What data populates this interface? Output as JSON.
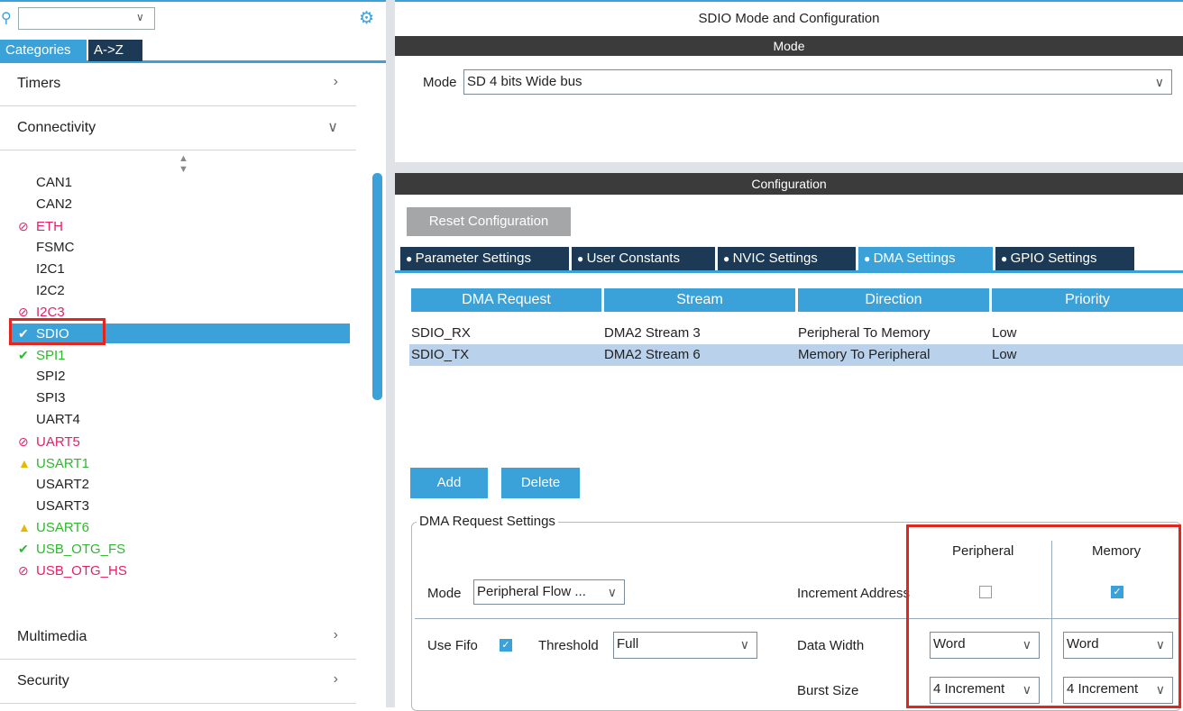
{
  "left": {
    "search": {
      "value": ""
    },
    "tabs": [
      "Categories",
      "A->Z"
    ],
    "categories": [
      {
        "label": "Timers",
        "arrow": ">"
      },
      {
        "label": "Connectivity",
        "arrow": "v"
      },
      {
        "label": "Multimedia",
        "arrow": ">"
      },
      {
        "label": "Security",
        "arrow": ">"
      }
    ],
    "items": [
      {
        "label": "CAN1",
        "status": "none"
      },
      {
        "label": "CAN2",
        "status": "none"
      },
      {
        "label": "ETH",
        "status": "disabled"
      },
      {
        "label": "FSMC",
        "status": "none"
      },
      {
        "label": "I2C1",
        "status": "none"
      },
      {
        "label": "I2C2",
        "status": "none"
      },
      {
        "label": "I2C3",
        "status": "disabled"
      },
      {
        "label": "SDIO",
        "status": "selected"
      },
      {
        "label": "SPI1",
        "status": "ok"
      },
      {
        "label": "SPI2",
        "status": "none"
      },
      {
        "label": "SPI3",
        "status": "none"
      },
      {
        "label": "UART4",
        "status": "none"
      },
      {
        "label": "UART5",
        "status": "disabled"
      },
      {
        "label": "USART1",
        "status": "warning"
      },
      {
        "label": "USART2",
        "status": "none"
      },
      {
        "label": "USART3",
        "status": "none"
      },
      {
        "label": "USART6",
        "status": "warning"
      },
      {
        "label": "USB_OTG_FS",
        "status": "ok"
      },
      {
        "label": "USB_OTG_HS",
        "status": "disabled"
      }
    ]
  },
  "right": {
    "title": "SDIO Mode and Configuration",
    "mode_bar": "Mode",
    "mode_label": "Mode",
    "mode_value": "SD 4 bits Wide bus",
    "config_bar": "Configuration",
    "reset_button": "Reset Configuration",
    "tabs": [
      "Parameter Settings",
      "User Constants",
      "NVIC Settings",
      "DMA Settings",
      "GPIO Settings"
    ],
    "table_headers": [
      "DMA Request",
      "Stream",
      "Direction",
      "Priority"
    ],
    "rows": [
      [
        "SDIO_RX",
        "DMA2 Stream 3",
        "Peripheral To Memory",
        "Low"
      ],
      [
        "SDIO_TX",
        "DMA2 Stream 6",
        "Memory To Peripheral",
        "Low"
      ]
    ],
    "add_button": "Add",
    "delete_button": "Delete",
    "dma_settings": {
      "legend": "DMA Request Settings",
      "col_peripheral": "Peripheral",
      "col_memory": "Memory",
      "mode_label": "Mode",
      "mode_value": "Peripheral Flow ...",
      "increment_label": "Increment Address",
      "use_fifo_label": "Use Fifo",
      "threshold_label": "Threshold",
      "threshold_value": "Full",
      "data_width_label": "Data Width",
      "periph_width": "Word",
      "mem_width": "Word",
      "burst_label": "Burst Size",
      "periph_burst": "4 Increment",
      "mem_burst": "4 Increment",
      "periph_increment": false,
      "mem_increment": true,
      "use_fifo": true
    }
  },
  "colors": {
    "accent": "#3aa1d9",
    "dark_tab": "#1c3a55",
    "highlight": "#e0261f"
  }
}
